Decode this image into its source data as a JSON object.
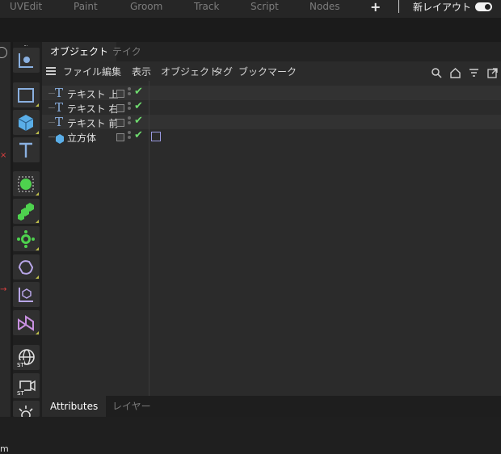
{
  "topbar": {
    "tabs": [
      "UVEdit",
      "Paint",
      "Groom",
      "Track",
      "Script",
      "Nodes"
    ],
    "add_icon": "plus-icon",
    "layout_label": "新レイアウト",
    "toggle_on": true
  },
  "panel": {
    "tabs": [
      "オブジェクト",
      "テイク"
    ],
    "menu": [
      "ファイル",
      "編集",
      "表示",
      "オブジェクト",
      "タグ",
      "ブックマーク"
    ],
    "menu_icons": [
      "search-icon",
      "home-icon",
      "filter-icon",
      "new-window-icon"
    ],
    "objects": [
      {
        "name": "テキスト 上",
        "icon": "text-icon",
        "visible": true,
        "has_tag": false
      },
      {
        "name": "テキスト 右",
        "icon": "text-icon",
        "visible": true,
        "has_tag": false
      },
      {
        "name": "テキスト 前",
        "icon": "text-icon",
        "visible": true,
        "has_tag": false
      },
      {
        "name": "立方体",
        "icon": "cube-icon",
        "visible": true,
        "has_tag": true
      }
    ]
  },
  "toolbar": {
    "tools": [
      "move-tool-icon",
      "rectangle-spline-icon",
      "cube-primitive-icon",
      "text-spline-icon",
      "subdivision-icon",
      "cloner-icon",
      "deformer-icon",
      "bend-icon",
      "coordinate-icon",
      "field-icon",
      "sky-icon",
      "camera-icon",
      "light-icon"
    ]
  },
  "left_edge": {
    "m_label": "m"
  },
  "bottom": {
    "tabs": [
      "Attributes",
      "レイヤー"
    ]
  },
  "colors": {
    "accent_green": "#6fdc6f",
    "text_icon": "#8ab0e0",
    "cube_icon": "#5aaee8"
  }
}
